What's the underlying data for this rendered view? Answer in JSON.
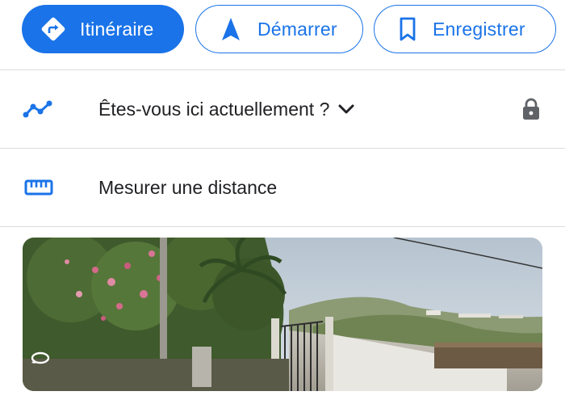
{
  "actions": {
    "route_label": "Itinéraire",
    "start_label": "Démarrer",
    "save_label": "Enregistrer"
  },
  "rows": {
    "location_prompt": "Êtes-vous ici actuellement ?",
    "measure_label": "Mesurer une distance"
  },
  "icons": {
    "route": "directions-icon",
    "start": "navigation-arrow-icon",
    "save": "bookmark-icon",
    "timeline": "timeline-icon",
    "chevron": "chevron-down-icon",
    "lock": "lock-icon",
    "ruler": "ruler-icon",
    "streetview": "360-rotate-icon"
  },
  "colors": {
    "accent": "#1a73e8",
    "text": "#202124",
    "muted": "#5f6368",
    "divider": "#dadce0"
  }
}
